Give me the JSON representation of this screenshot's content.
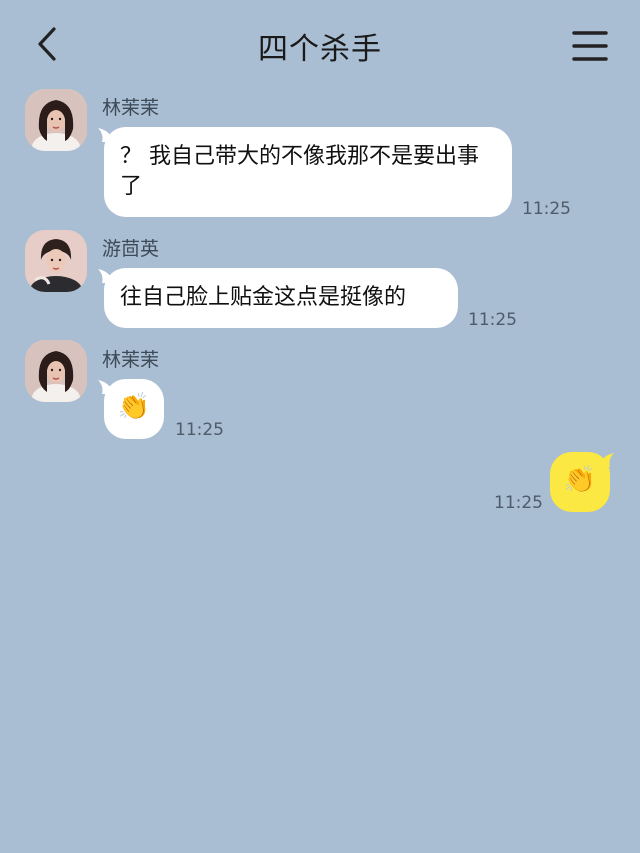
{
  "header": {
    "title": "四个杀手"
  },
  "messages": [
    {
      "sender": "林茉茉",
      "text": "？ 我自己带大的不像我那不是要出事了",
      "time": "11:25"
    },
    {
      "sender": "游茴英",
      "text": "往自己脸上贴金这点是挺像的",
      "time": "11:25"
    },
    {
      "sender": "林茉茉",
      "text": "👏",
      "time": "11:25"
    },
    {
      "sender": "",
      "text": "👏",
      "time": "11:25"
    }
  ],
  "colors": {
    "background": "#a9bdd3",
    "incoming_bubble": "#ffffff",
    "outgoing_bubble": "#fbe843"
  },
  "icons": {
    "back": "chevron-left-icon",
    "menu": "hamburger-menu-icon"
  }
}
